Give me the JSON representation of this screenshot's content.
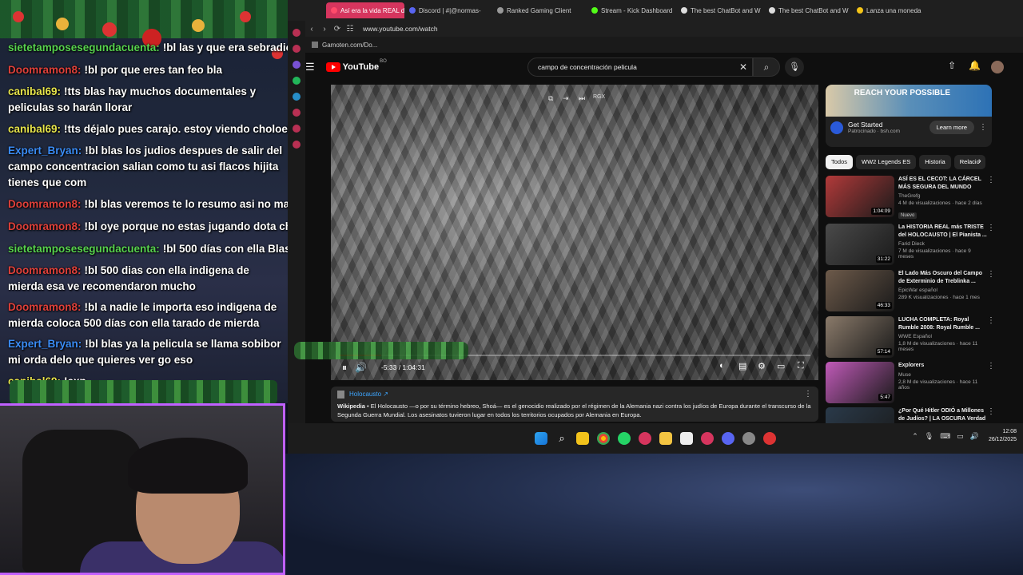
{
  "chat": {
    "messages": [
      {
        "user": "sietetamposesegundacuenta:",
        "text": "!bl las y que era sebradio",
        "cls": "u-siete"
      },
      {
        "user": "Doomramon8:",
        "text": "!bl por que eres tan feo bla",
        "cls": "u-doom"
      },
      {
        "user": "canibal69:",
        "text": "!tts blas hay muchos documentales y peliculas so harán llorar",
        "cls": "u-canibal",
        "wrap": true
      },
      {
        "user": "canibal69:",
        "text": "!tts déjalo pues carajo. estoy viendo choloebierda",
        "cls": "u-canibal"
      },
      {
        "user": "Expert_Bryan:",
        "text": "!bl blas los judios despues de salir del campo concentracion salian como tu asi flacos hijita tienes que com",
        "cls": "u-expert",
        "wrap": true
      },
      {
        "user": "Doomramon8:",
        "text": "!bl blas veremos te lo resumo asi no mas",
        "cls": "u-doom"
      },
      {
        "user": "Doomramon8:",
        "text": "!bl oye porque no estas jugando dota cholo de",
        "cls": "u-doom"
      },
      {
        "user": "sietetamposesegundacuenta:",
        "text": "!bl 500 días con ella Blas",
        "cls": "u-siete"
      },
      {
        "user": "Doomramon8:",
        "text": "!bl 500 dias con ella indigena de mierda esa ve recomendaron mucho",
        "cls": "u-doom",
        "wrap": true
      },
      {
        "user": "Doomramon8:",
        "text": "!bl a nadie le importa eso indigena de mierda coloca 500 días con ella tarado de mierda",
        "cls": "u-doom",
        "wrap": true
      },
      {
        "user": "Expert_Bryan:",
        "text": "!bl blas ya la pelicula se llama sobibor mi orda delo que quieres ver go eso",
        "cls": "u-expert",
        "wrap": true
      },
      {
        "user": "canibal69:",
        "text": "!exp",
        "cls": "u-canibal"
      }
    ]
  },
  "browser": {
    "tabs": [
      {
        "label": "Así era la vida REAL d",
        "active": true,
        "color": "#ff4a6a"
      },
      {
        "label": "Discord | #|@normas-",
        "active": false,
        "color": "#5865f2"
      },
      {
        "label": "Ranked Gaming Client",
        "active": false,
        "color": "#999999"
      },
      {
        "label": "Stream - Kick Dashboard",
        "active": false,
        "color": "#53fc18"
      },
      {
        "label": "The best ChatBot and W",
        "active": false,
        "color": "#dddddd"
      },
      {
        "label": "The best ChatBot and W",
        "active": false,
        "color": "#dddddd"
      },
      {
        "label": "Lanza una moneda",
        "active": false,
        "color": "#f5c518"
      }
    ],
    "url": "www.youtube.com/watch",
    "bookmark": "Gamoten.com/Do..."
  },
  "youtube": {
    "logo": "YouTube",
    "country": "BO",
    "search_value": "campo de concentración pelicula",
    "player": {
      "time": "-5:33 / 1:04:31",
      "progress": 0.09,
      "quality": "RGX"
    },
    "info_panel": {
      "title": "Holocausto ↗",
      "source": "Wikipedia",
      "text": " • El Holocausto —o por su término hebreo, Shoá— es el genocidio realizado por el régimen de la Alemania nazi contra los judíos de Europa durante el transcurso de la Segunda Guerra Mundial. Los asesinatos tuvieron lugar en todos los territorios ocupados por Alemania en Europa."
    },
    "ad": {
      "banner": "REACH YOUR POSSIBLE",
      "title": "Get Started",
      "sponsor": "Patrocinado · bsh.com",
      "button": "Learn more"
    },
    "chips": [
      "Todos",
      "WW2 Legends ES",
      "Historia",
      "Relacio"
    ],
    "recommendations": [
      {
        "title": "ASÍ ES EL CECOT: LA CÁRCEL MÁS SEGURA DEL MUNDO",
        "channel": "TheGrefg",
        "views": "4 M de visualizaciones · hace 2 días",
        "badge": "Nuevo",
        "duration": "1:04:09",
        "color": "#b23a3a"
      },
      {
        "title": "La HISTORIA REAL más TRISTE del HOLOCAUSTO | El Pianista ...",
        "channel": "Farid Dieck",
        "views": "7 M de visualizaciones · hace 9 meses",
        "badge": "",
        "duration": "31:22",
        "color": "#4a4a4a"
      },
      {
        "title": "El Lado Más Oscuro del Campo de Exterminio de Treblinka ...",
        "channel": "EpicWar español",
        "views": "289 K visualizaciones · hace 1 mes",
        "badge": "",
        "duration": "46:33",
        "color": "#6d5a4a"
      },
      {
        "title": "LUCHA COMPLETA: Royal Rumble 2008: Royal Rumble ...",
        "channel": "WWE Español",
        "views": "1,8 M de visualizaciones · hace 11 meses",
        "badge": "",
        "duration": "57:14",
        "color": "#8a7a6a"
      },
      {
        "title": "Explorers",
        "channel": "Muse",
        "views": "2,8 M de visualizaciones · hace 11 años",
        "badge": "",
        "duration": "5:47",
        "color": "#c05ab8"
      },
      {
        "title": "¿Por Qué Hitler ODIÓ a Millones de Judíos? | LA OSCURA Verdad",
        "channel": "",
        "views": "",
        "badge": "",
        "duration": "",
        "color": "#2a3a4a"
      }
    ]
  },
  "taskbar": {
    "time": "12:08",
    "date": "26/12/2025"
  }
}
